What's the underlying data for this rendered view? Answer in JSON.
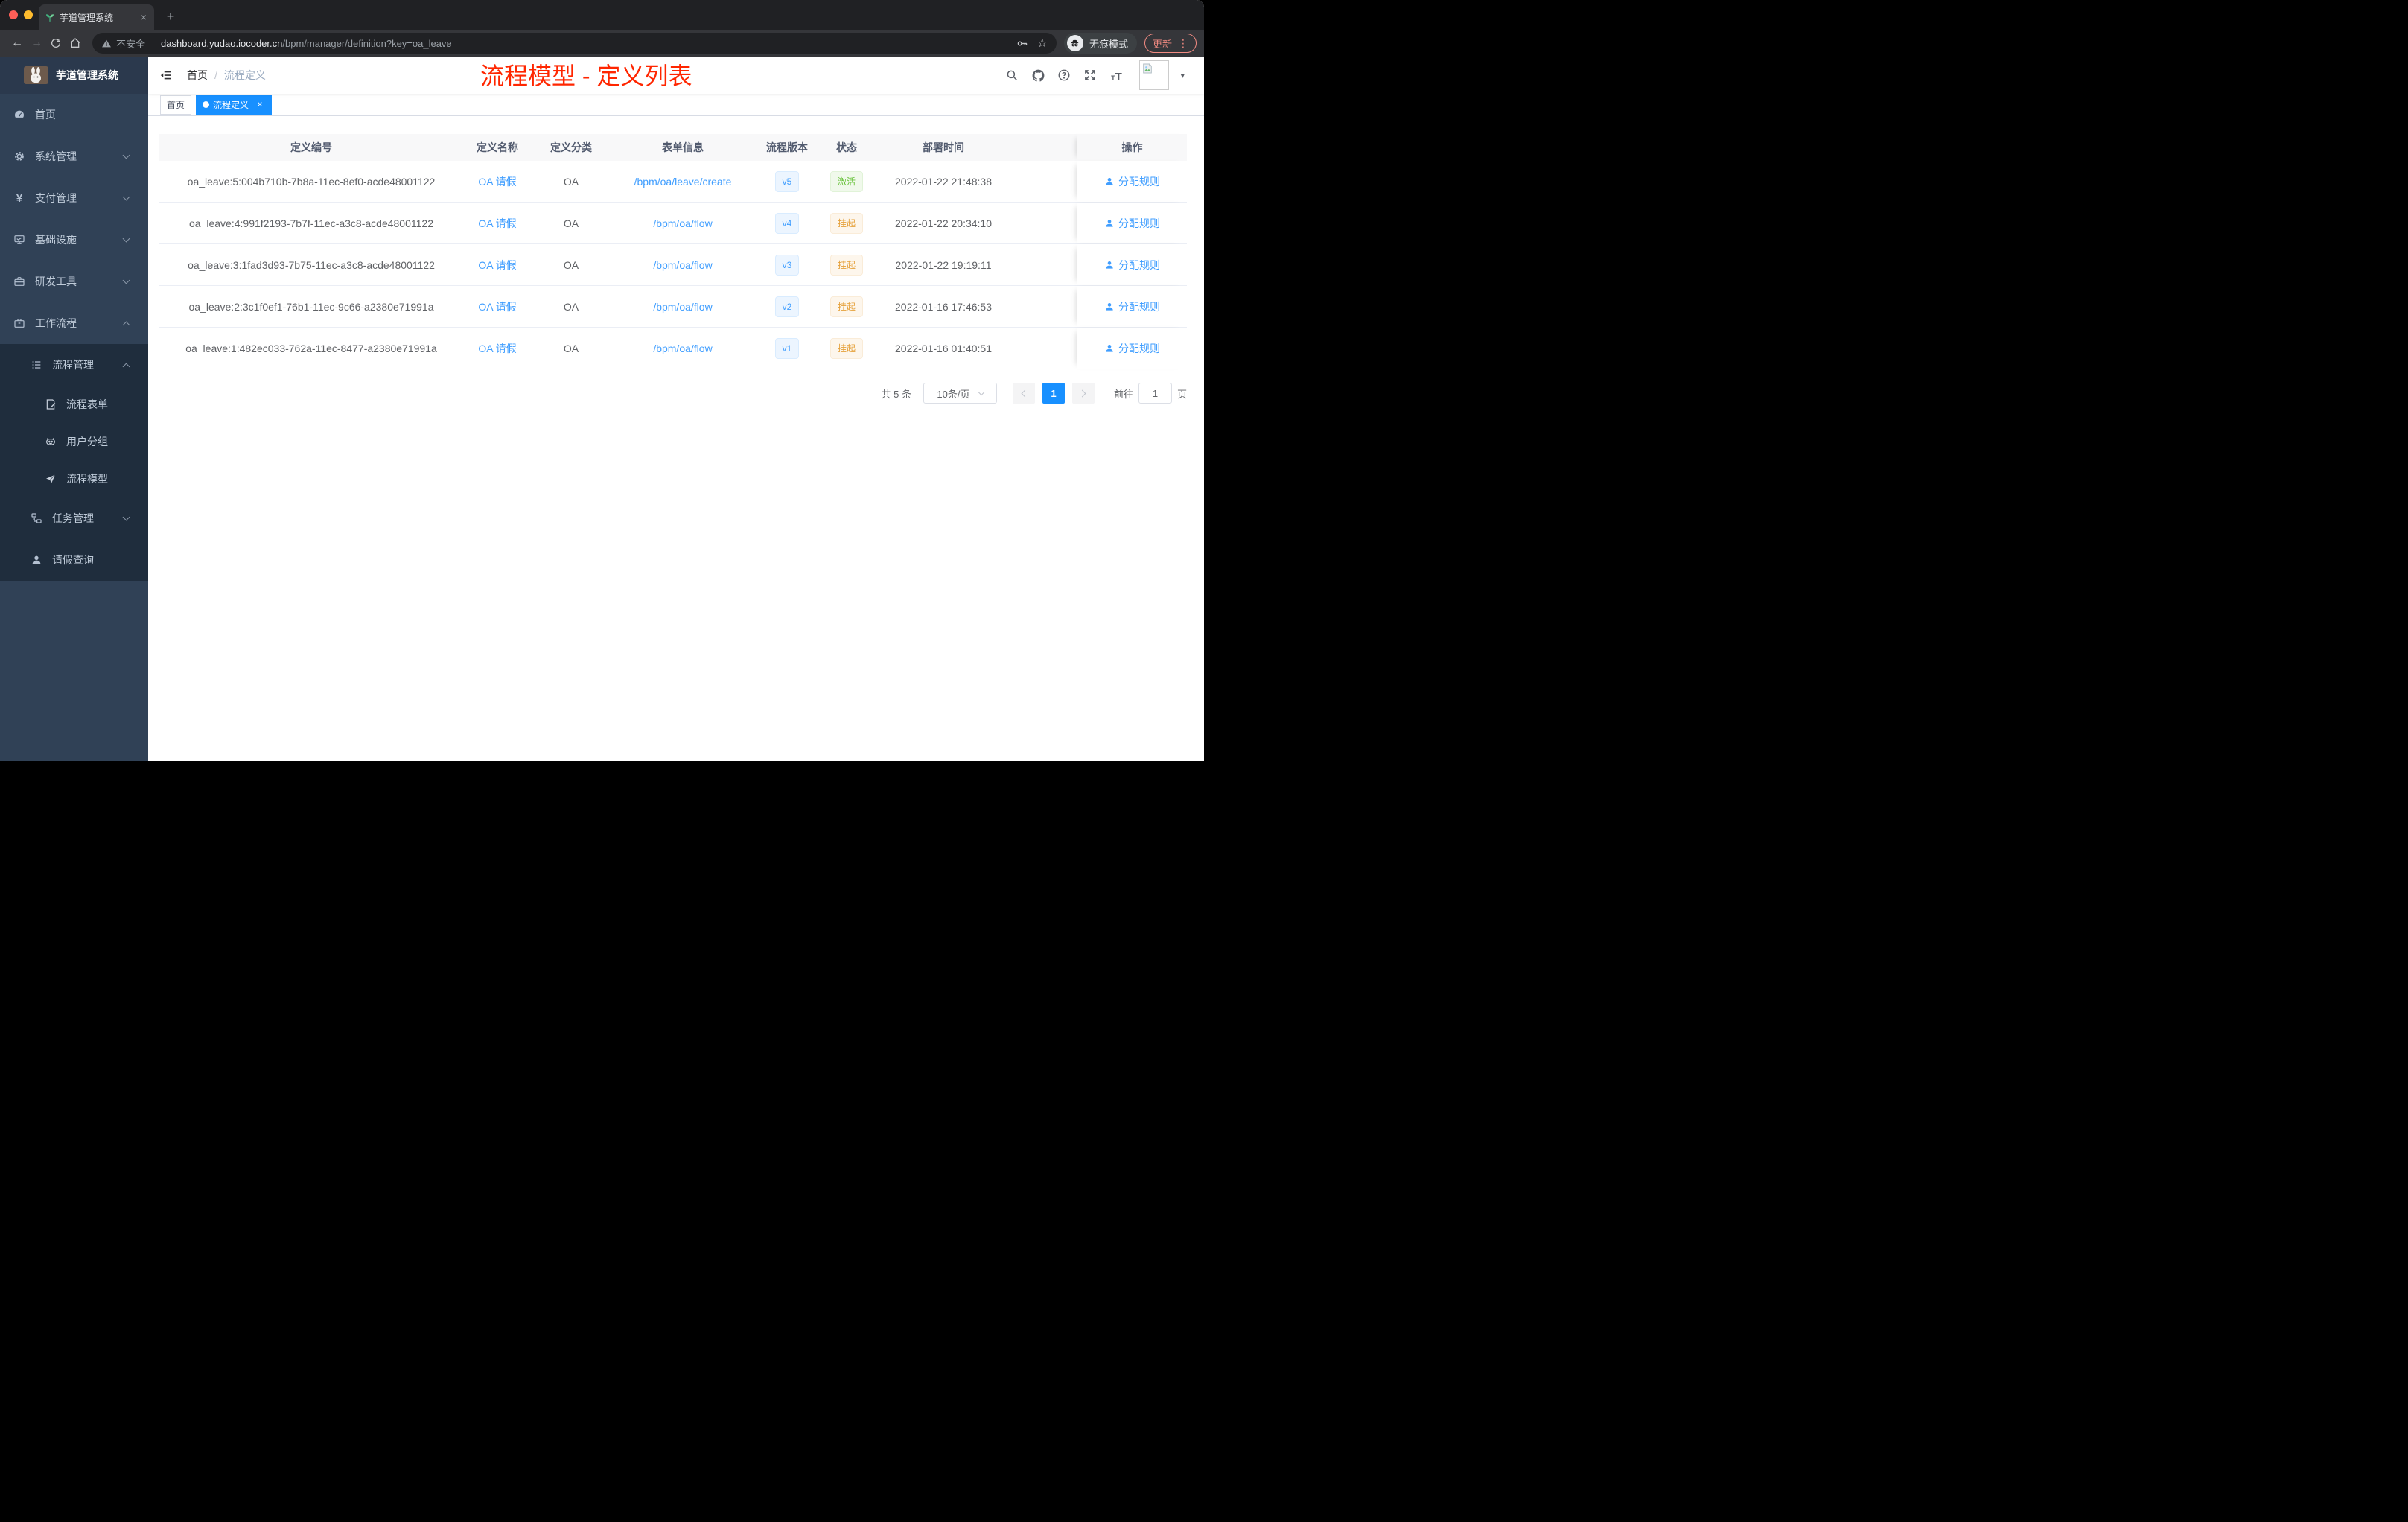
{
  "colors": {
    "theme_blue": "#1890ff",
    "link_blue": "#409eff",
    "status_active_green": "#67c23a",
    "status_suspend_orange": "#e6a23c",
    "annotation_red": "#ff2600",
    "chrome_update_red": "#f28b82",
    "sidebar_bg": "#304156",
    "submenu_bg": "#1f2d3d"
  },
  "browser": {
    "tab_title": "芋道管理系统",
    "address": {
      "security": "不安全",
      "host": "dashboard.yudao.iocoder.cn",
      "path": "/bpm/manager/definition?key=oa_leave"
    },
    "incognito_label": "无痕模式",
    "update_label": "更新"
  },
  "glyphs": {
    "close": "×",
    "new_tab": "+",
    "back": "←",
    "forward": "→",
    "bookmark_star": "☆",
    "more_vertical": "⋮",
    "yen": "¥",
    "question": "?",
    "font_small": "T",
    "font_large": "T",
    "caret_down": "▾"
  },
  "sidebar": {
    "logo_title": "芋道管理系统",
    "menu": [
      {
        "label": "首页"
      },
      {
        "label": "系统管理"
      },
      {
        "label": "支付管理"
      },
      {
        "label": "基础设施"
      },
      {
        "label": "研发工具"
      },
      {
        "label": "工作流程"
      }
    ],
    "submenu": [
      {
        "label": "流程管理"
      },
      {
        "label": "流程表单"
      },
      {
        "label": "用户分组"
      },
      {
        "label": "流程模型"
      },
      {
        "label": "任务管理"
      },
      {
        "label": "请假查询"
      }
    ]
  },
  "navbar": {
    "breadcrumb_home": "首页",
    "breadcrumb_sep": "/",
    "breadcrumb_current": "流程定义",
    "annotation": "流程模型 - 定义列表"
  },
  "tags": {
    "home": "首页",
    "active": "流程定义"
  },
  "table": {
    "columns": [
      "定义编号",
      "定义名称",
      "定义分类",
      "表单信息",
      "流程版本",
      "状态",
      "部署时间",
      "操作"
    ],
    "action_label": "分配规则",
    "rows": [
      {
        "id": "oa_leave:5:004b710b-7b8a-11ec-8ef0-acde48001122",
        "name": "OA 请假",
        "category": "OA",
        "form": "/bpm/oa/leave/create",
        "version": "v5",
        "status": "激活",
        "time": "2022-01-22 21:48:38"
      },
      {
        "id": "oa_leave:4:991f2193-7b7f-11ec-a3c8-acde48001122",
        "name": "OA 请假",
        "category": "OA",
        "form": "/bpm/oa/flow",
        "version": "v4",
        "status": "挂起",
        "time": "2022-01-22 20:34:10"
      },
      {
        "id": "oa_leave:3:1fad3d93-7b75-11ec-a3c8-acde48001122",
        "name": "OA 请假",
        "category": "OA",
        "form": "/bpm/oa/flow",
        "version": "v3",
        "status": "挂起",
        "time": "2022-01-22 19:19:11"
      },
      {
        "id": "oa_leave:2:3c1f0ef1-76b1-11ec-9c66-a2380e71991a",
        "name": "OA 请假",
        "category": "OA",
        "form": "/bpm/oa/flow",
        "version": "v2",
        "status": "挂起",
        "time": "2022-01-16 17:46:53"
      },
      {
        "id": "oa_leave:1:482ec033-762a-11ec-8477-a2380e71991a",
        "name": "OA 请假",
        "category": "OA",
        "form": "/bpm/oa/flow",
        "version": "v1",
        "status": "挂起",
        "time": "2022-01-16 01:40:51"
      }
    ]
  },
  "pagination": {
    "total": "共 5 条",
    "page_size": "10条/页",
    "current_page": "1",
    "goto_label": "前往",
    "goto_value": "1",
    "unit_label": "页"
  }
}
